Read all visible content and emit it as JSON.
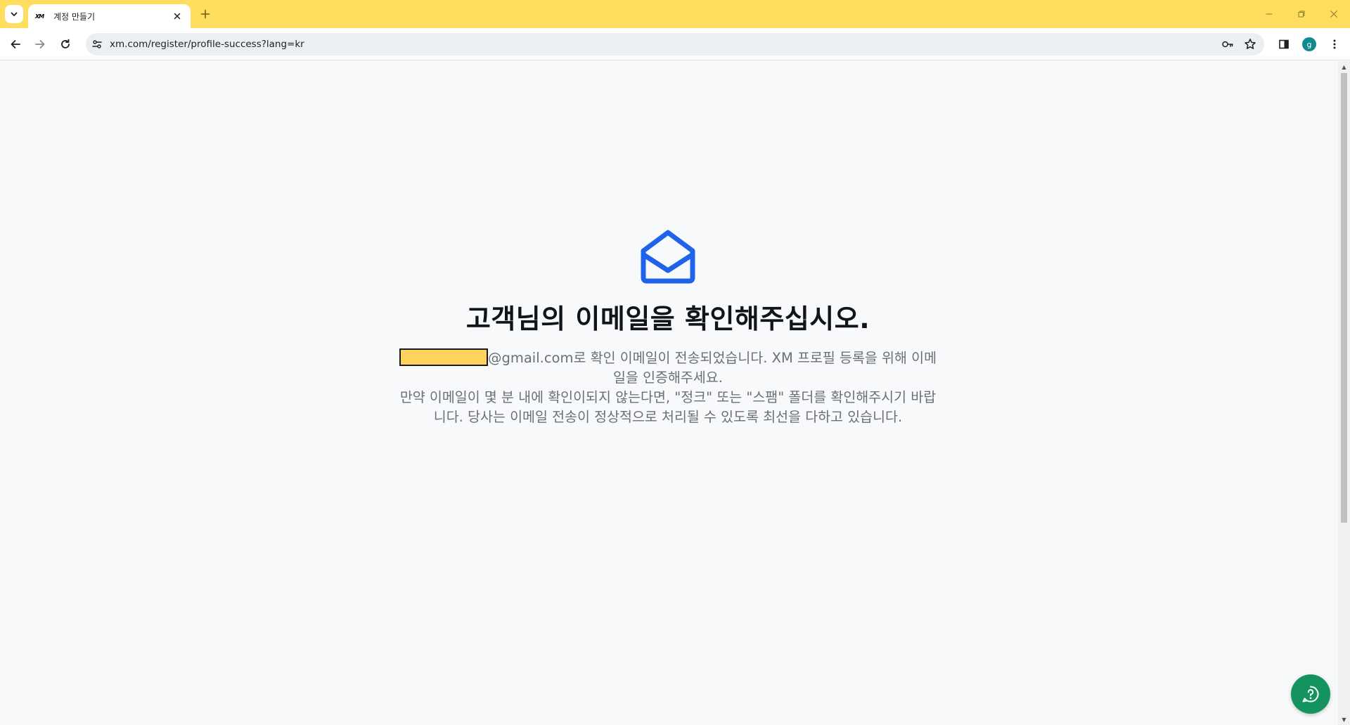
{
  "browser": {
    "tab": {
      "favicon_text": "XM",
      "title": "계정 만들기"
    },
    "address_bar": {
      "url": "xm.com/register/profile-success?lang=kr"
    },
    "profile_initial": "g"
  },
  "page": {
    "heading": "고객님의 이메일을 확인해주십시오.",
    "email_domain": "@gmail.com",
    "message_line1": "로 확인 이메일이 전송되었습니다. XM 프로필 등록을 위해 이메일을 인증해주세요.",
    "message_line2": "만약 이메일이 몇 분 내에 확인이되지 않는다면, \"정크\" 또는 \"스팸\" 폴더를 확인해주시기 바랍니다. 당사는 이메일 전송이 정상적으로 처리될 수 있도록 최선을 다하고 있습니다."
  },
  "colors": {
    "tabstrip": "#ffdd5e",
    "mail_icon": "#1e63e9",
    "help_button": "#15935f",
    "email_mask": "#ffd45e"
  }
}
